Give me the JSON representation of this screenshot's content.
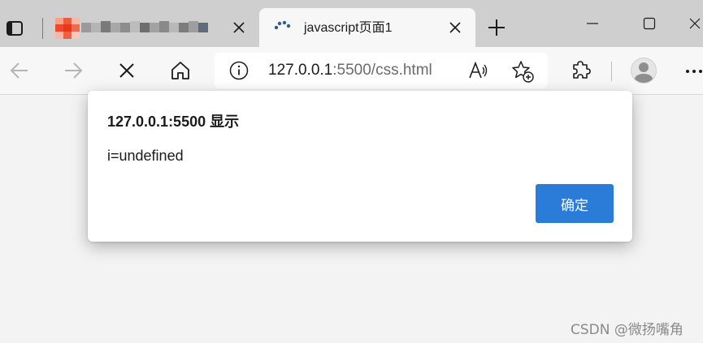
{
  "tabs": [
    {
      "title": "",
      "active": false,
      "favicon": "blurred-favicon-icon"
    },
    {
      "title": "javascript页面1",
      "active": true,
      "favicon": "loading-spinner-icon"
    }
  ],
  "toolbar": {
    "icons": [
      "back-arrow-icon",
      "forward-arrow-icon",
      "stop-loading-icon",
      "home-icon"
    ],
    "url_host": "127.0.0.1",
    "url_path": ":5500/css.html",
    "site_info_icon": "info-icon",
    "read_aloud_icon": "read-aloud-icon",
    "favorites_icon": "add-favorite-icon",
    "extensions_icon": "puzzle-icon",
    "profile_icon": "avatar-icon",
    "more_icon": "more-icon"
  },
  "dialog": {
    "title": "127.0.0.1:5500 显示",
    "message": "i=undefined",
    "ok_label": "确定"
  },
  "colors": {
    "accent": "#2b7bd8",
    "tabstrip": "#cfcfcf",
    "toolbar": "#f7f7f7",
    "page": "#f3f3f3"
  },
  "watermark": "CSDN @微扬嘴角"
}
